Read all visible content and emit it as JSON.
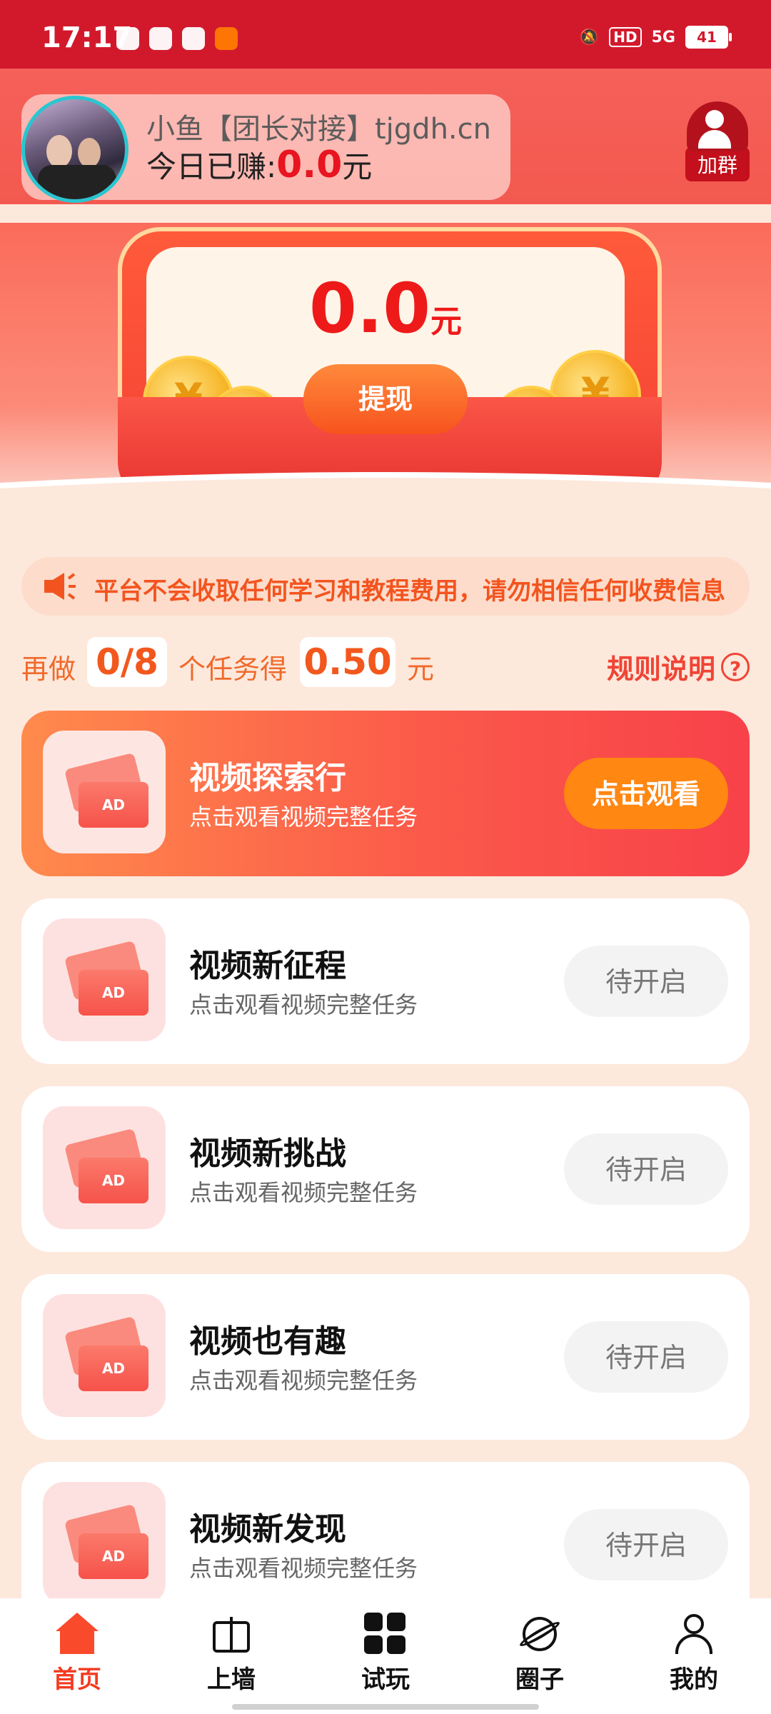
{
  "status_bar": {
    "time": "17:17",
    "hd": "HD",
    "network": "5G",
    "battery": "41"
  },
  "header": {
    "user_name": "小鱼【团长对接】tjgdh.cn",
    "earned_label": "今日已赚:",
    "earned_amount": "0.0",
    "earned_unit": "元",
    "join_group_label": "加群"
  },
  "wallet": {
    "balance": "0.0",
    "unit": "元",
    "coin_symbol": "¥",
    "withdraw_label": "提现"
  },
  "notice": {
    "text": "平台不会收取任何学习和教程费用，请勿相信任何收费信息"
  },
  "progress": {
    "prefix": "再做",
    "count": "0/8",
    "middle": "个任务得",
    "reward": "0.50",
    "suffix": "元",
    "rules_label": "规则说明",
    "rules_icon": "?"
  },
  "tasks": [
    {
      "title": "视频探索行",
      "subtitle": "点击观看视频完整任务",
      "button": "点击观看",
      "badge": "AD"
    },
    {
      "title": "视频新征程",
      "subtitle": "点击观看视频完整任务",
      "button": "待开启",
      "badge": "AD"
    },
    {
      "title": "视频新挑战",
      "subtitle": "点击观看视频完整任务",
      "button": "待开启",
      "badge": "AD"
    },
    {
      "title": "视频也有趣",
      "subtitle": "点击观看视频完整任务",
      "button": "待开启",
      "badge": "AD"
    },
    {
      "title": "视频新发现",
      "subtitle": "点击观看视频完整任务",
      "button": "待开启",
      "badge": "AD"
    }
  ],
  "tabbar": [
    {
      "label": "首页",
      "icon": "home-icon",
      "active": true
    },
    {
      "label": "上墙",
      "icon": "gift-icon",
      "active": false
    },
    {
      "label": "试玩",
      "icon": "grid-icon",
      "active": false
    },
    {
      "label": "圈子",
      "icon": "planet-icon",
      "active": false
    },
    {
      "label": "我的",
      "icon": "profile-icon",
      "active": false
    }
  ],
  "colors": {
    "primary_red": "#d2192c",
    "accent_orange": "#ff8712",
    "amount_red": "#e8141f"
  }
}
